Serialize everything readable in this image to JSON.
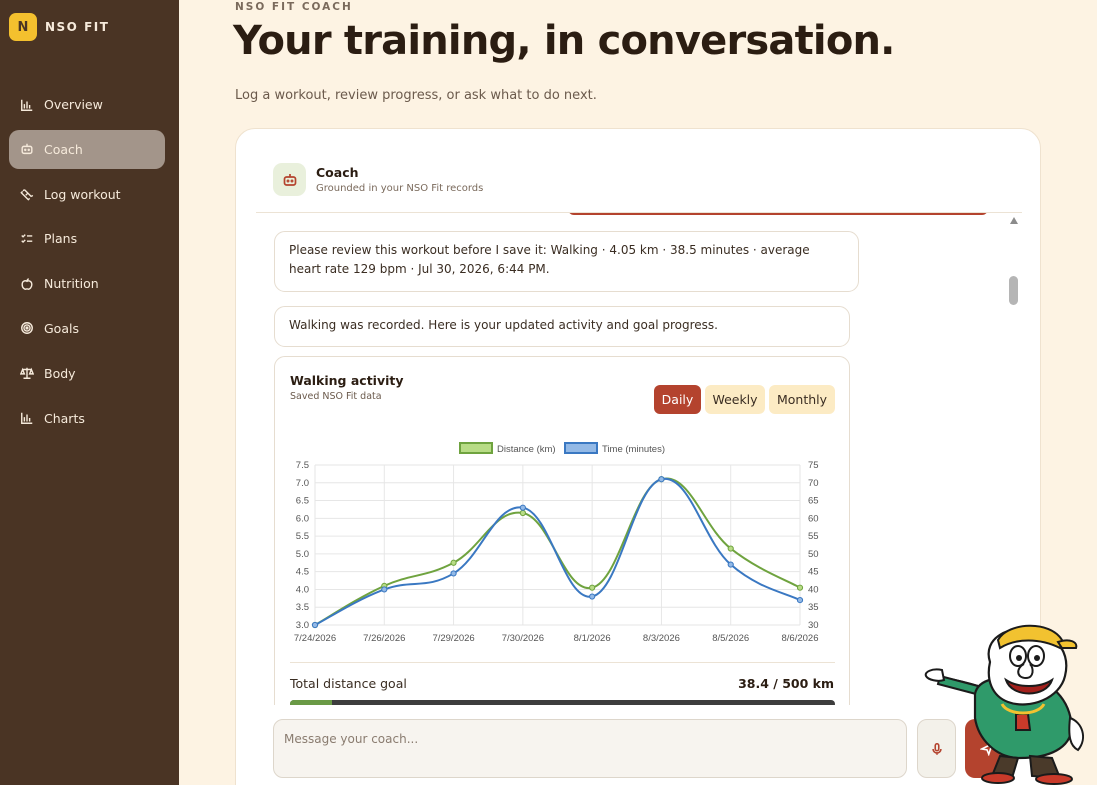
{
  "brand": {
    "logo_letter": "N",
    "name": "NSO FIT"
  },
  "sidebar": {
    "items": [
      {
        "label": "Overview",
        "icon": "bar-chart-icon",
        "active": false
      },
      {
        "label": "Coach",
        "icon": "robot-icon",
        "active": true
      },
      {
        "label": "Log workout",
        "icon": "dumbbell-icon",
        "active": false
      },
      {
        "label": "Plans",
        "icon": "checklist-icon",
        "active": false
      },
      {
        "label": "Nutrition",
        "icon": "apple-icon",
        "active": false
      },
      {
        "label": "Goals",
        "icon": "target-icon",
        "active": false
      },
      {
        "label": "Body",
        "icon": "scale-icon",
        "active": false
      },
      {
        "label": "Charts",
        "icon": "bar-chart-icon",
        "active": false
      }
    ]
  },
  "header": {
    "eyebrow": "NSO FIT COACH",
    "title": "Your training, in conversation.",
    "subtitle": "Log a workout, review progress, or ask what to do next."
  },
  "coach": {
    "name": "Coach",
    "subtitle": "Grounded in your NSO Fit records"
  },
  "messages": [
    {
      "text": "Please review this workout before I save it: Walking · 4.05 km · 38.5 minutes · average heart rate 129 bpm · Jul 30, 2026, 6:44 PM."
    },
    {
      "text": "Walking was recorded. Here is your updated activity and goal progress."
    }
  ],
  "activity_card": {
    "title": "Walking activity",
    "subtitle": "Saved NSO Fit data",
    "ranges": [
      "Daily",
      "Weekly",
      "Monthly"
    ],
    "selected_range": "Daily",
    "goal_label": "Total distance goal",
    "goal_value": "38.4 / 500 km",
    "goal_progress": 0.077
  },
  "composer": {
    "placeholder": "Message your coach..."
  },
  "colors": {
    "accent": "#b4432e",
    "sidebar": "#4a3424",
    "background": "#fdf3e3",
    "distance": "#6fa33f",
    "time": "#3a78c2"
  },
  "chart_data": {
    "type": "line",
    "x": [
      "7/24/2026",
      "7/26/2026",
      "7/29/2026",
      "7/30/2026",
      "8/1/2026",
      "8/3/2026",
      "8/5/2026",
      "8/6/2026"
    ],
    "series": [
      {
        "name": "Distance (km)",
        "axis": "left",
        "values": [
          3.0,
          4.1,
          4.75,
          6.15,
          4.05,
          7.1,
          5.15,
          4.05
        ]
      },
      {
        "name": "Time (minutes)",
        "axis": "right",
        "values": [
          30,
          40,
          44.5,
          63,
          38,
          71,
          47,
          37
        ]
      }
    ],
    "y_left": {
      "ticks": [
        "3.0",
        "3.5",
        "4.0",
        "4.5",
        "5.0",
        "5.5",
        "6.0",
        "6.5",
        "7.0",
        "7.5"
      ],
      "range": [
        3.0,
        7.5
      ]
    },
    "y_right": {
      "ticks": [
        "30",
        "35",
        "40",
        "45",
        "50",
        "55",
        "60",
        "65",
        "70",
        "75"
      ],
      "range": [
        30,
        75
      ]
    },
    "legend": "top-center",
    "grid": true
  }
}
